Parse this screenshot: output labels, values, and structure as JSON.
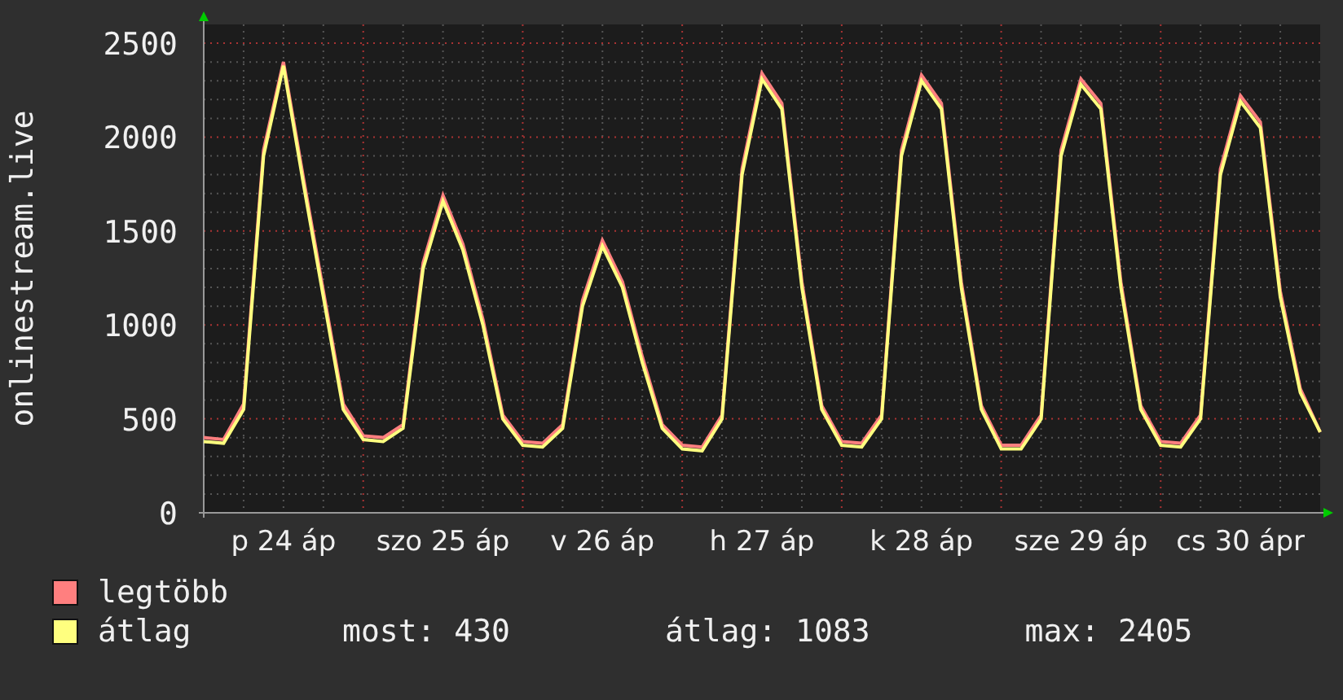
{
  "chart_data": {
    "type": "line",
    "ylabel": "onlinestream.live",
    "categories": [
      null,
      null,
      null,
      null,
      "p 24 áp",
      null,
      null,
      null,
      null,
      null,
      null,
      null,
      "szo 25 áp",
      null,
      null,
      null,
      null,
      null,
      null,
      null,
      "v 26 áp",
      null,
      null,
      null,
      null,
      null,
      null,
      null,
      "h 27 áp",
      null,
      null,
      null,
      null,
      null,
      null,
      null,
      "k 28 áp",
      null,
      null,
      null,
      null,
      null,
      null,
      null,
      "sze 29 áp",
      null,
      null,
      null,
      null,
      null,
      null,
      null,
      "cs 30 ápr",
      null,
      null,
      null,
      null
    ],
    "ylim": [
      0,
      2600
    ],
    "grid": true,
    "yticks": [
      0,
      500,
      1000,
      1500,
      2000,
      2500
    ],
    "series": [
      {
        "name": "legtöbb",
        "color": "#ff7f7f",
        "values": [
          400,
          390,
          580,
          1930,
          2400,
          1780,
          1180,
          580,
          410,
          400,
          470,
          1330,
          1690,
          1430,
          1030,
          520,
          380,
          370,
          470,
          1130,
          1450,
          1230,
          830,
          470,
          360,
          350,
          520,
          1830,
          2340,
          2180,
          1230,
          570,
          380,
          370,
          520,
          1930,
          2330,
          2180,
          1230,
          570,
          360,
          360,
          520,
          1930,
          2310,
          2180,
          1230,
          570,
          380,
          370,
          520,
          1830,
          2220,
          2080,
          1180,
          660,
          430
        ]
      },
      {
        "name": "átlag",
        "color": "#ffff7f",
        "values": [
          380,
          370,
          550,
          1900,
          2380,
          1750,
          1150,
          550,
          390,
          380,
          450,
          1300,
          1660,
          1400,
          1000,
          500,
          360,
          350,
          450,
          1100,
          1420,
          1200,
          800,
          450,
          340,
          330,
          500,
          1800,
          2310,
          2150,
          1200,
          550,
          360,
          350,
          500,
          1900,
          2300,
          2150,
          1200,
          550,
          340,
          340,
          500,
          1900,
          2280,
          2150,
          1200,
          550,
          360,
          350,
          500,
          1800,
          2190,
          2050,
          1150,
          640,
          430
        ]
      }
    ]
  },
  "stats": [
    "most: 430",
    "átlag: 1083",
    "max: 2405"
  ]
}
